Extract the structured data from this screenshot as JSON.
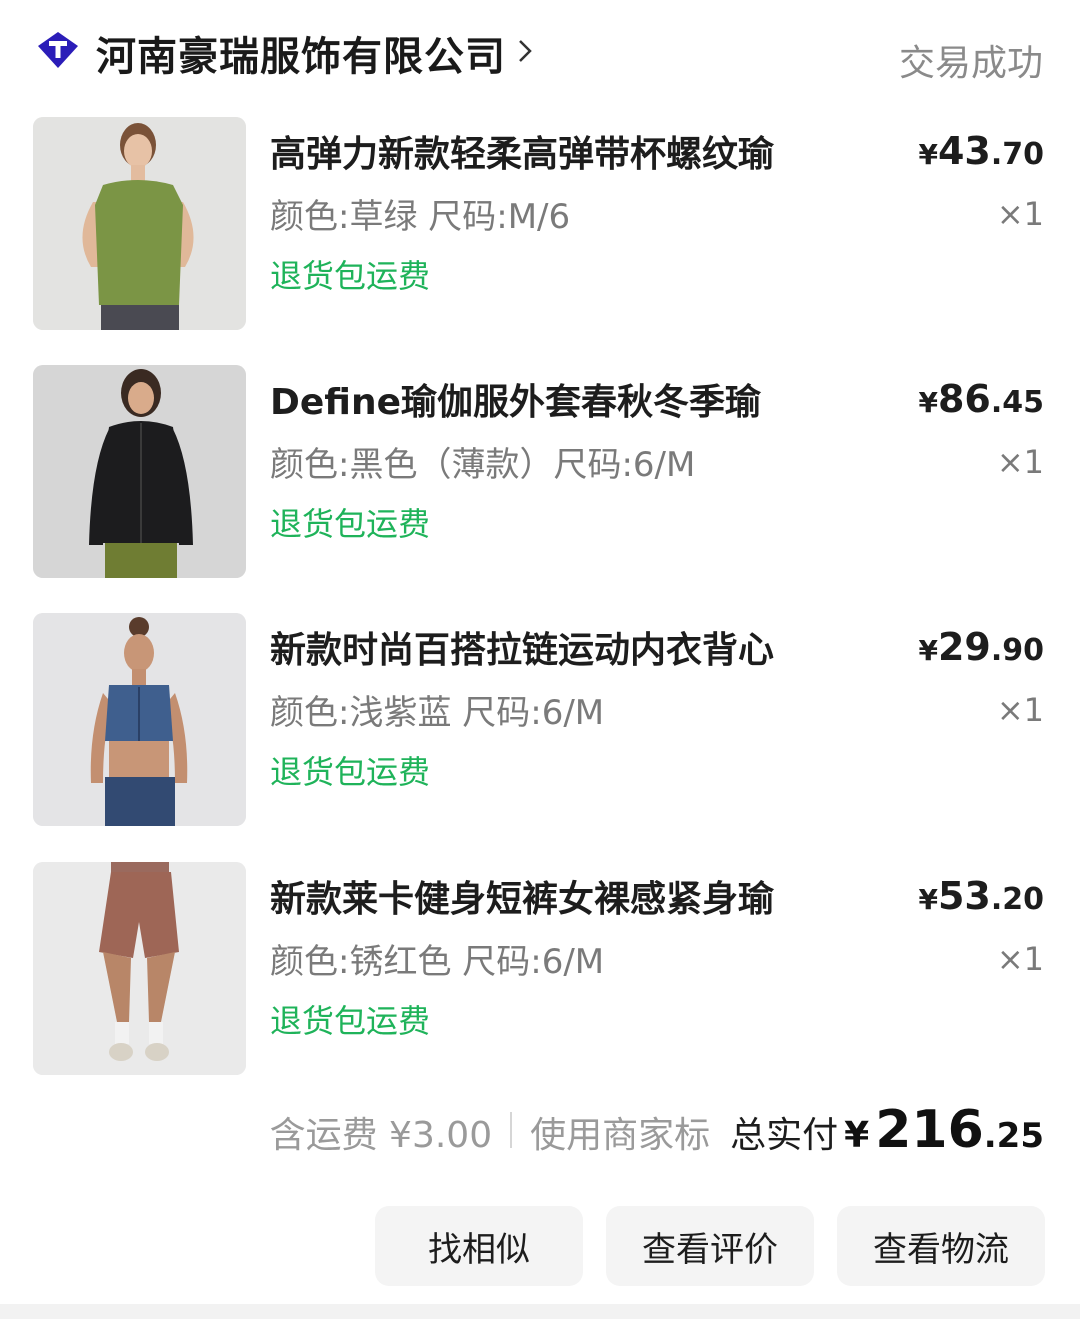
{
  "shop": {
    "name": "河南豪瑞服饰有限公司",
    "chevron_icon": "chevron-right-icon",
    "logo_icon": "shop-logo-icon",
    "logo_color": "#2b1db8",
    "status": "交易成功"
  },
  "items": [
    {
      "title": "高弹力新款轻柔高弹带杯螺纹瑜",
      "spec": "颜色:草绿 尺码:M/6",
      "tag": "退货包运费",
      "price_currency": "¥",
      "price_int": "43",
      "price_dec": ".70",
      "qty": "×1",
      "image_icon": "green-tank-top-photo"
    },
    {
      "title": "Define瑜伽服外套春秋冬季瑜",
      "spec": "颜色:黑色（薄款）尺码:6/M",
      "tag": "退货包运费",
      "price_currency": "¥",
      "price_int": "86",
      "price_dec": ".45",
      "qty": "×1",
      "image_icon": "black-jacket-photo"
    },
    {
      "title": "新款时尚百搭拉链运动内衣背心",
      "spec": "颜色:浅紫蓝 尺码:6/M",
      "tag": "退货包运费",
      "price_currency": "¥",
      "price_int": "29",
      "price_dec": ".90",
      "qty": "×1",
      "image_icon": "blue-sports-bra-photo"
    },
    {
      "title": "新款莱卡健身短裤女裸感紧身瑜",
      "spec": "颜色:锈红色 尺码:6/M",
      "tag": "退货包运费",
      "price_currency": "¥",
      "price_int": "53",
      "price_dec": ".20",
      "qty": "×1",
      "image_icon": "rust-shorts-photo"
    }
  ],
  "summary": {
    "shipping": "含运费 ¥3.00",
    "merchant_mark": "使用商家标",
    "total_label": "总实付",
    "total_currency": "¥",
    "total_int": "216",
    "total_dec": ".25"
  },
  "actions": {
    "find_similar": "找相似",
    "view_review": "查看评价",
    "view_logistics": "查看物流"
  },
  "colors": {
    "tag_green": "#1fb35a",
    "status_gray": "#8a8a8a",
    "button_bg": "#f4f4f4"
  }
}
